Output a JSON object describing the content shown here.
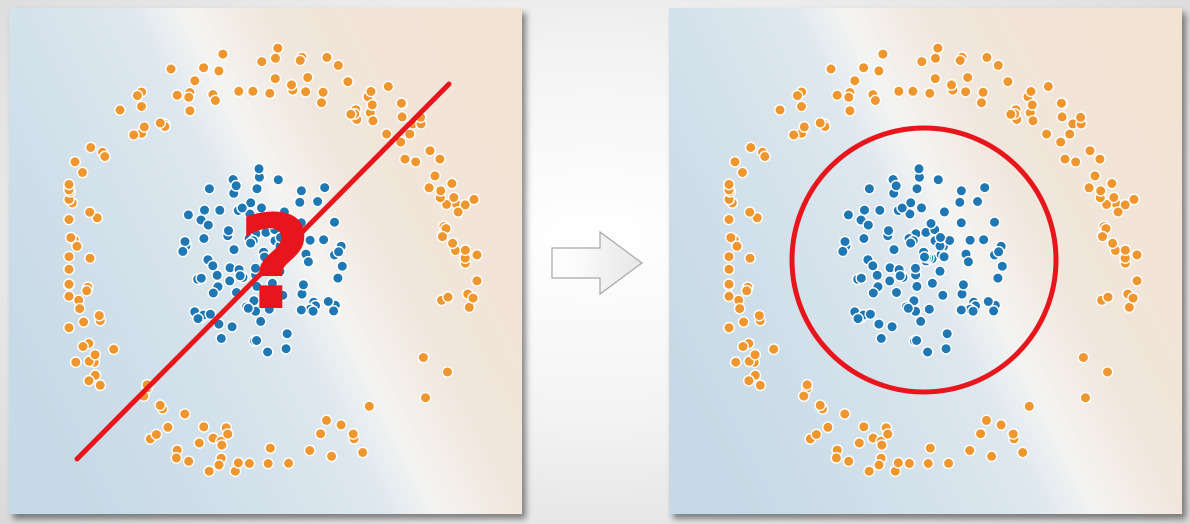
{
  "colors": {
    "inner_class": "#1f77b4",
    "outer_class": "#f0962e",
    "annotation": "#e8151c",
    "background_left": "#c5d9e6",
    "background_right": "#f2e3d3"
  },
  "annotation": {
    "question_mark": "?"
  },
  "panels": [
    {
      "id": "left-panel",
      "boundary": "straight-line",
      "marked": "question-mark"
    },
    {
      "id": "right-panel",
      "boundary": "circle",
      "marked": "none"
    }
  ],
  "icons": {
    "transition": "right-arrow-icon"
  }
}
